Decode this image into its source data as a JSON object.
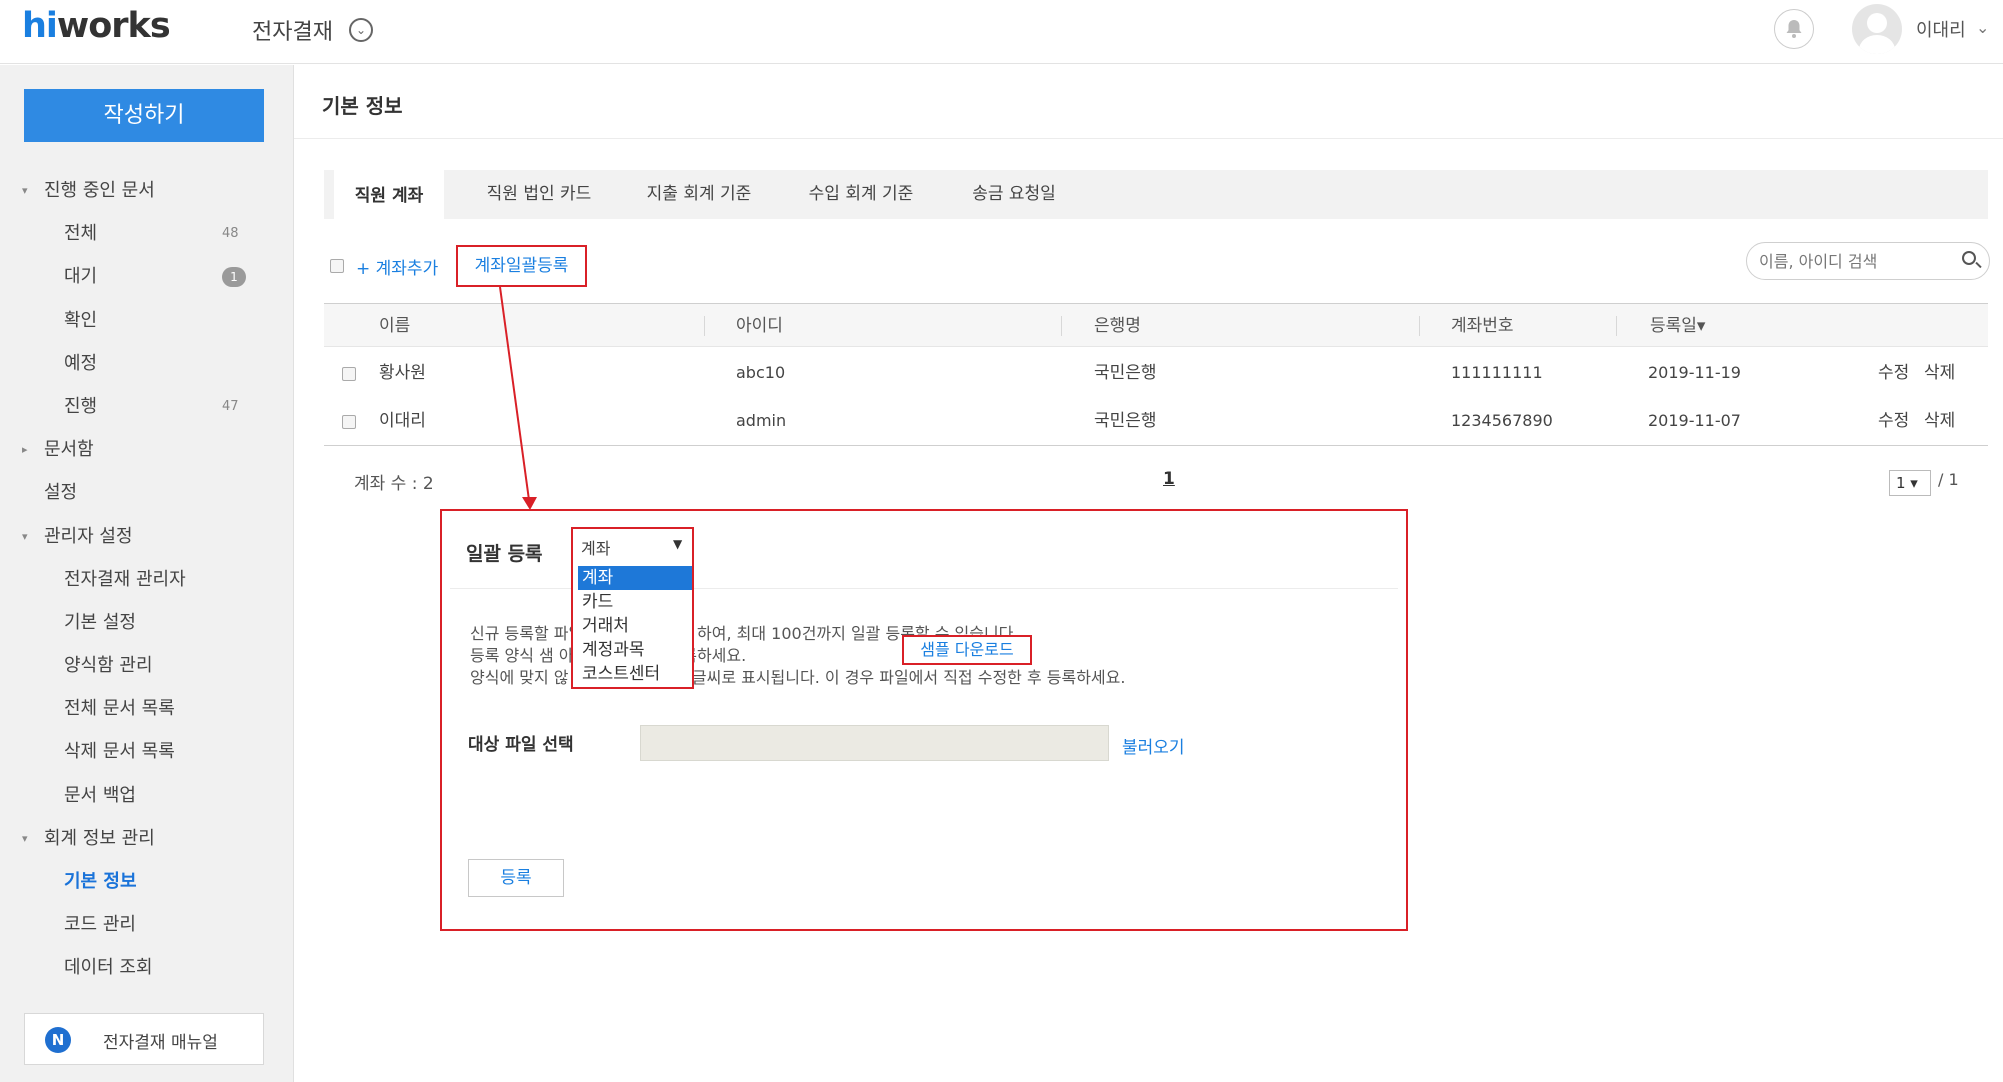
{
  "header": {
    "logo_hi": "hi",
    "logo_rest": "works",
    "app_title": "전자결재",
    "app_caret": "⌄",
    "user_name": "이대리",
    "user_caret": "⌄",
    "bell_glyph": "🔔"
  },
  "sidebar": {
    "compose_label": "작성하기",
    "items": [
      {
        "label": "진행 중인 문서",
        "level": 0,
        "arrow": "▾"
      },
      {
        "label": "전체",
        "level": 1,
        "count": "48"
      },
      {
        "label": "대기",
        "level": 1,
        "badge": "1"
      },
      {
        "label": "확인",
        "level": 1
      },
      {
        "label": "예정",
        "level": 1
      },
      {
        "label": "진행",
        "level": 1,
        "count": "47"
      },
      {
        "label": "문서함",
        "level": 0,
        "arrow": "▸"
      },
      {
        "label": "설정",
        "level": 0
      },
      {
        "label": "관리자 설정",
        "level": 0,
        "arrow": "▾"
      },
      {
        "label": "전자결재 관리자",
        "level": 1
      },
      {
        "label": "기본 설정",
        "level": 1
      },
      {
        "label": "양식함 관리",
        "level": 1
      },
      {
        "label": "전체 문서 목록",
        "level": 1
      },
      {
        "label": "삭제 문서 목록",
        "level": 1
      },
      {
        "label": "문서 백업",
        "level": 1
      },
      {
        "label": "회계 정보 관리",
        "level": 0,
        "arrow": "▾"
      },
      {
        "label": "기본 정보",
        "level": 1,
        "active": true
      },
      {
        "label": "코드 관리",
        "level": 1
      },
      {
        "label": "데이터 조회",
        "level": 1
      }
    ],
    "manual_icon": "N",
    "manual_label": "전자결재 매뉴얼"
  },
  "main": {
    "page_title": "기본 정보",
    "tabs": [
      {
        "label": "직원 계좌",
        "active": true
      },
      {
        "label": "직원 법인 카드"
      },
      {
        "label": "지출 회계 기준"
      },
      {
        "label": "수입 회계 기준"
      },
      {
        "label": "송금 요청일"
      }
    ],
    "add_account": "+ 계좌추가",
    "bulk_register": "계좌일괄등록",
    "search_placeholder": "이름, 아이디 검색",
    "table": {
      "headers": [
        "이름",
        "아이디",
        "은행명",
        "계좌번호",
        "등록일▾"
      ],
      "rows": [
        {
          "name": "황사원",
          "id": "abc10",
          "bank": "국민은행",
          "account": "111111111",
          "date": "2019-11-19",
          "edit": "수정",
          "delete": "삭제"
        },
        {
          "name": "이대리",
          "id": "admin",
          "bank": "국민은행",
          "account": "1234567890",
          "date": "2019-11-07",
          "edit": "수정",
          "delete": "삭제"
        }
      ]
    },
    "account_count": "계좌 수 : 2",
    "page_current": "1",
    "page_select": "1 ▾",
    "page_total": "/ 1"
  },
  "modal": {
    "title": "일괄 등록",
    "dropdown": {
      "selected": "계좌",
      "caret": "▼",
      "options": [
        "계좌",
        "카드",
        "거래처",
        "계정과목",
        "코스트센터"
      ]
    },
    "desc_line1": "신규 등록할                        파일(CSV)로 업로드 하여, 최대 100건까지 일괄 등록할 수 있습니다.",
    "desc_line2": "등록 양식 샘                        아, 회계 정보를 등록하세요.",
    "desc_line3": "양식에 맞지 않                     않은 정보는 빨간 글씨로 표시됩니다. 이 경우 파일에서 직접 수정한 후 등록하세요.",
    "sample_download": "샘플 다운로드",
    "file_label": "대상 파일 선택",
    "load_link": "불러오기",
    "submit": "등록"
  },
  "colors": {
    "accent": "#2f8ae3",
    "link": "#1a7fe0",
    "highlight_red": "#d92027"
  }
}
